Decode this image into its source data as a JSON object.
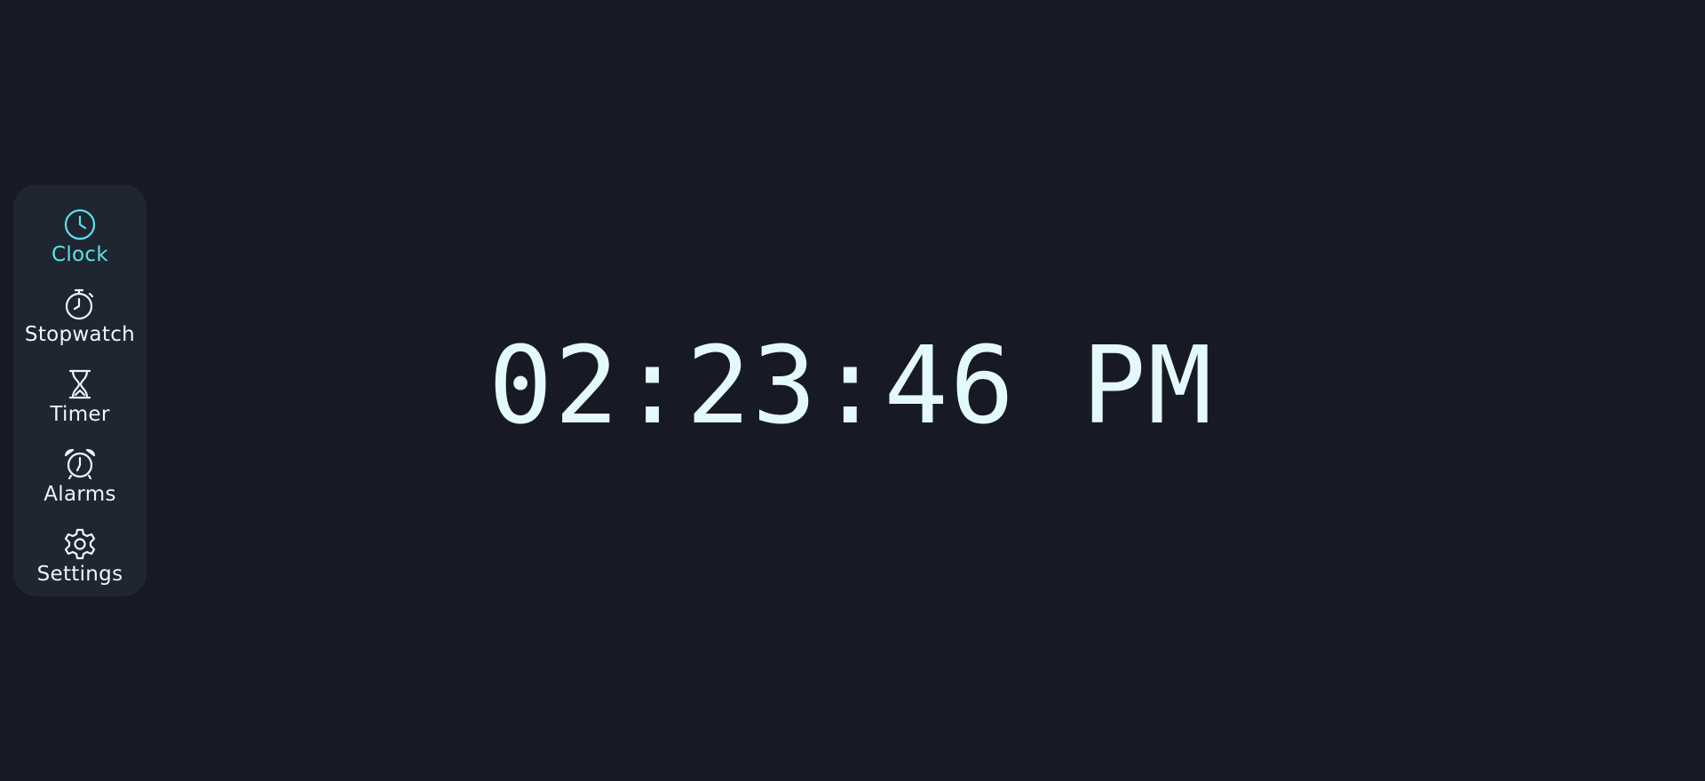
{
  "colors": {
    "background": "#171a25",
    "sidebar": "#1f2631",
    "accent": "#5ee1ea",
    "text": "#f0f4fa",
    "clock_text": "#e4f9fb"
  },
  "sidebar": {
    "active": "clock",
    "items": [
      {
        "id": "clock",
        "label": "Clock",
        "icon": "clock-icon"
      },
      {
        "id": "stopwatch",
        "label": "Stopwatch",
        "icon": "stopwatch-icon"
      },
      {
        "id": "timer",
        "label": "Timer",
        "icon": "hourglass-icon"
      },
      {
        "id": "alarms",
        "label": "Alarms",
        "icon": "alarm-clock-icon"
      },
      {
        "id": "settings",
        "label": "Settings",
        "icon": "gear-icon"
      }
    ]
  },
  "main": {
    "time": "02:23:46 PM"
  }
}
